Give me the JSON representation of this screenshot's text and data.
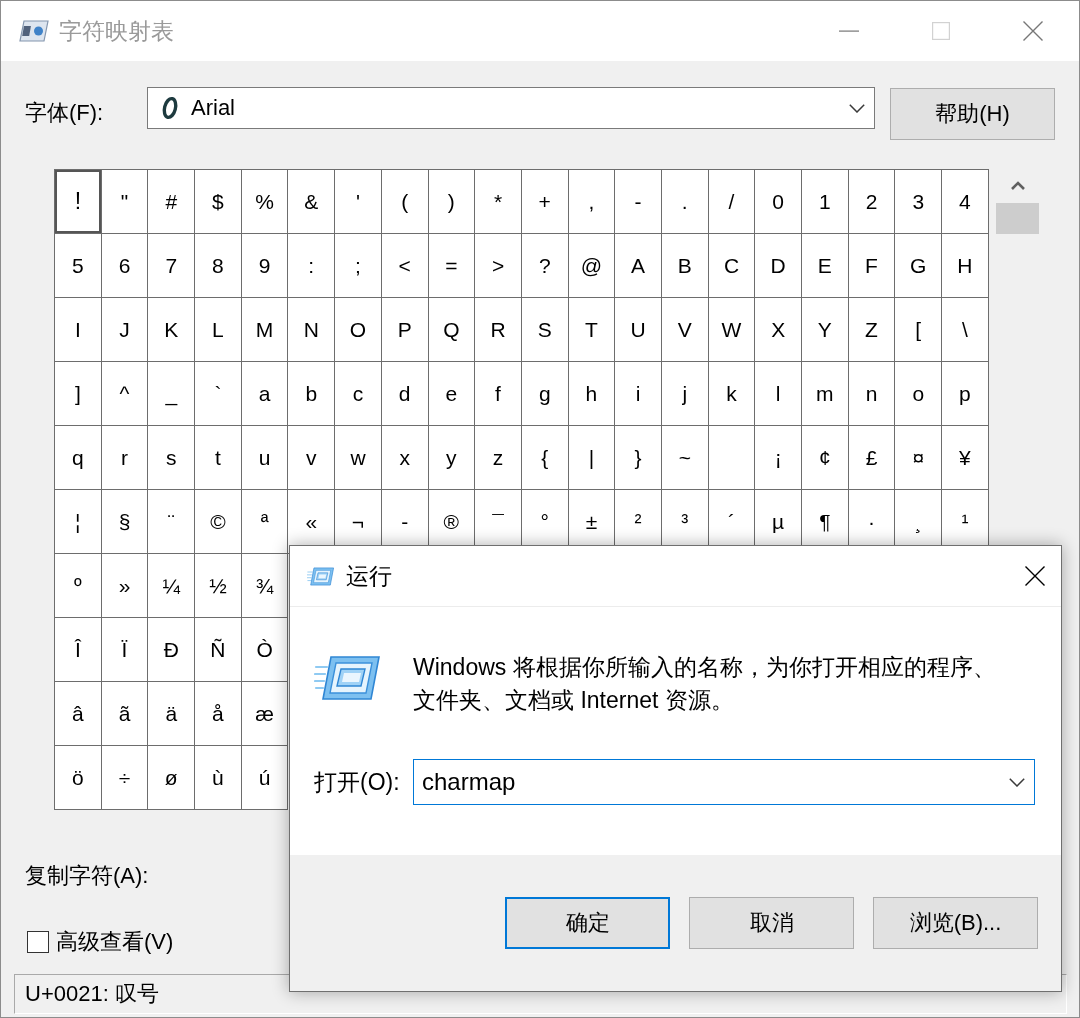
{
  "charmap": {
    "title": "字符映射表",
    "active": false,
    "title_buttons": [
      {
        "kind": "minimize",
        "disabled": false
      },
      {
        "kind": "maximize",
        "disabled": true
      },
      {
        "kind": "close",
        "disabled": false
      }
    ],
    "font_label": "字体(F):",
    "font": {
      "value": "Arial"
    },
    "help_button": "帮助(H)",
    "grid": {
      "rows": [
        [
          {
            "char": "!",
            "selected": true
          },
          {
            "char": "\"",
            "selected": false
          },
          {
            "char": "#",
            "selected": false
          },
          {
            "char": "$",
            "selected": false
          },
          {
            "char": "%",
            "selected": false
          },
          {
            "char": "&",
            "selected": false
          },
          {
            "char": "'",
            "selected": false
          },
          {
            "char": "(",
            "selected": false
          },
          {
            "char": ")",
            "selected": false
          },
          {
            "char": "*",
            "selected": false
          },
          {
            "char": "+",
            "selected": false
          },
          {
            "char": ",",
            "selected": false
          },
          {
            "char": "-",
            "selected": false
          },
          {
            "char": ".",
            "selected": false
          },
          {
            "char": "/",
            "selected": false
          },
          {
            "char": "0",
            "selected": false
          },
          {
            "char": "1",
            "selected": false
          },
          {
            "char": "2",
            "selected": false
          },
          {
            "char": "3",
            "selected": false
          },
          {
            "char": "4",
            "selected": false
          }
        ],
        [
          {
            "char": "5",
            "selected": false
          },
          {
            "char": "6",
            "selected": false
          },
          {
            "char": "7",
            "selected": false
          },
          {
            "char": "8",
            "selected": false
          },
          {
            "char": "9",
            "selected": false
          },
          {
            "char": ":",
            "selected": false
          },
          {
            "char": ";",
            "selected": false
          },
          {
            "char": "<",
            "selected": false
          },
          {
            "char": "=",
            "selected": false
          },
          {
            "char": ">",
            "selected": false
          },
          {
            "char": "?",
            "selected": false
          },
          {
            "char": "@",
            "selected": false
          },
          {
            "char": "A",
            "selected": false
          },
          {
            "char": "B",
            "selected": false
          },
          {
            "char": "C",
            "selected": false
          },
          {
            "char": "D",
            "selected": false
          },
          {
            "char": "E",
            "selected": false
          },
          {
            "char": "F",
            "selected": false
          },
          {
            "char": "G",
            "selected": false
          },
          {
            "char": "H",
            "selected": false
          }
        ],
        [
          {
            "char": "I",
            "selected": false
          },
          {
            "char": "J",
            "selected": false
          },
          {
            "char": "K",
            "selected": false
          },
          {
            "char": "L",
            "selected": false
          },
          {
            "char": "M",
            "selected": false
          },
          {
            "char": "N",
            "selected": false
          },
          {
            "char": "O",
            "selected": false
          },
          {
            "char": "P",
            "selected": false
          },
          {
            "char": "Q",
            "selected": false
          },
          {
            "char": "R",
            "selected": false
          },
          {
            "char": "S",
            "selected": false
          },
          {
            "char": "T",
            "selected": false
          },
          {
            "char": "U",
            "selected": false
          },
          {
            "char": "V",
            "selected": false
          },
          {
            "char": "W",
            "selected": false
          },
          {
            "char": "X",
            "selected": false
          },
          {
            "char": "Y",
            "selected": false
          },
          {
            "char": "Z",
            "selected": false
          },
          {
            "char": "[",
            "selected": false
          },
          {
            "char": "\\",
            "selected": false
          }
        ],
        [
          {
            "char": "]",
            "selected": false
          },
          {
            "char": "^",
            "selected": false
          },
          {
            "char": "_",
            "selected": false
          },
          {
            "char": "`",
            "selected": false
          },
          {
            "char": "a",
            "selected": false
          },
          {
            "char": "b",
            "selected": false
          },
          {
            "char": "c",
            "selected": false
          },
          {
            "char": "d",
            "selected": false
          },
          {
            "char": "e",
            "selected": false
          },
          {
            "char": "f",
            "selected": false
          },
          {
            "char": "g",
            "selected": false
          },
          {
            "char": "h",
            "selected": false
          },
          {
            "char": "i",
            "selected": false
          },
          {
            "char": "j",
            "selected": false
          },
          {
            "char": "k",
            "selected": false
          },
          {
            "char": "l",
            "selected": false
          },
          {
            "char": "m",
            "selected": false
          },
          {
            "char": "n",
            "selected": false
          },
          {
            "char": "o",
            "selected": false
          },
          {
            "char": "p",
            "selected": false
          }
        ],
        [
          {
            "char": "q",
            "selected": false
          },
          {
            "char": "r",
            "selected": false
          },
          {
            "char": "s",
            "selected": false
          },
          {
            "char": "t",
            "selected": false
          },
          {
            "char": "u",
            "selected": false
          },
          {
            "char": "v",
            "selected": false
          },
          {
            "char": "w",
            "selected": false
          },
          {
            "char": "x",
            "selected": false
          },
          {
            "char": "y",
            "selected": false
          },
          {
            "char": "z",
            "selected": false
          },
          {
            "char": "{",
            "selected": false
          },
          {
            "char": "|",
            "selected": false
          },
          {
            "char": "}",
            "selected": false
          },
          {
            "char": "~",
            "selected": false
          },
          {
            "selected": false
          },
          {
            "char": "¡",
            "selected": false
          },
          {
            "char": "¢",
            "selected": false
          },
          {
            "char": "£",
            "selected": false
          },
          {
            "char": "¤",
            "selected": false
          },
          {
            "char": "¥",
            "selected": false
          }
        ],
        [
          {
            "char": "¦",
            "selected": false
          },
          {
            "char": "§",
            "selected": false
          },
          {
            "char": "¨",
            "selected": false
          },
          {
            "char": "©",
            "selected": false
          },
          {
            "char": "ª",
            "selected": false
          },
          {
            "char": "«",
            "selected": false
          },
          {
            "char": "¬",
            "selected": false
          },
          {
            "char": "-",
            "selected": false
          },
          {
            "char": "®",
            "selected": false
          },
          {
            "char": "¯",
            "selected": false
          },
          {
            "char": "°",
            "selected": false
          },
          {
            "char": "±",
            "selected": false
          },
          {
            "char": "²",
            "selected": false
          },
          {
            "char": "³",
            "selected": false
          },
          {
            "char": "´",
            "selected": false
          },
          {
            "char": "µ",
            "selected": false
          },
          {
            "char": "¶",
            "selected": false
          },
          {
            "char": "·",
            "selected": false
          },
          {
            "char": "¸",
            "selected": false
          },
          {
            "char": "¹",
            "selected": false
          }
        ],
        [
          {
            "char": "º",
            "selected": false
          },
          {
            "char": "»",
            "selected": false
          },
          {
            "char": "¼",
            "selected": false
          },
          {
            "char": "½",
            "selected": false
          },
          {
            "char": "¾",
            "selected": false
          }
        ],
        [
          {
            "char": "Î",
            "selected": false
          },
          {
            "char": "Ï",
            "selected": false
          },
          {
            "char": "Ð",
            "selected": false
          },
          {
            "char": "Ñ",
            "selected": false
          },
          {
            "char": "Ò",
            "selected": false
          }
        ],
        [
          {
            "char": "â",
            "selected": false
          },
          {
            "char": "ã",
            "selected": false
          },
          {
            "char": "ä",
            "selected": false
          },
          {
            "char": "å",
            "selected": false
          },
          {
            "char": "æ",
            "selected": false
          }
        ],
        [
          {
            "char": "ö",
            "selected": false
          },
          {
            "char": "÷",
            "selected": false
          },
          {
            "char": "ø",
            "selected": false
          },
          {
            "char": "ù",
            "selected": false
          },
          {
            "char": "ú",
            "selected": false
          }
        ]
      ]
    },
    "copy_label": "复制字符(A):",
    "advanced_view": {
      "label": "高级查看(V)",
      "checked": false
    },
    "status": "U+0021: 叹号"
  },
  "run_dialog": {
    "title": "运行",
    "active": true,
    "description": "Windows 将根据你所输入的名称，为你打开相应的程序、文件夹、文档或 Internet 资源。",
    "open_label": "打开(O):",
    "open_field": {
      "value": "charmap"
    },
    "buttons": [
      {
        "label": "确定",
        "default": true
      },
      {
        "label": "取消",
        "default": false
      },
      {
        "label": "浏览(B)...",
        "default": false
      }
    ]
  }
}
